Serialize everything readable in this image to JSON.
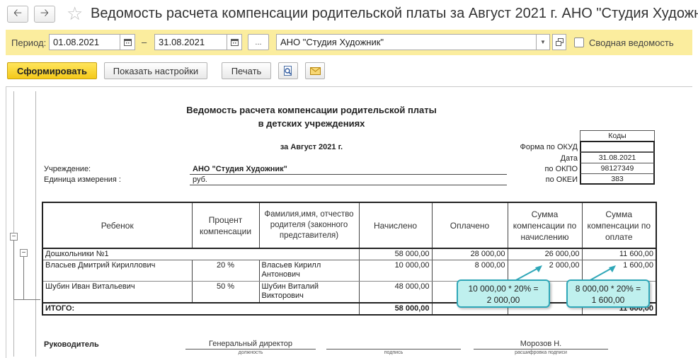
{
  "window": {
    "title": "Ведомость расчета компенсации родительской платы за Август 2021 г. АНО \"Студия Художник\""
  },
  "params": {
    "period_label": "Период:",
    "date_from": "01.08.2021",
    "dash": "–",
    "date_to": "31.08.2021",
    "ellipsis": "...",
    "org": "АНО \"Студия Художник\"",
    "summary_label": "Сводная ведомость"
  },
  "toolbar": {
    "generate": "Сформировать",
    "settings": "Показать настройки",
    "print": "Печать"
  },
  "report": {
    "title_line1": "Ведомость расчета компенсации родительской платы",
    "title_line2": "в детских учреждениях",
    "period": "за Август 2021 г.",
    "institution_label": "Учреждение:",
    "institution": "АНО \"Студия Художник\"",
    "unit_label": "Единица измерения :",
    "unit": "руб.",
    "codes": {
      "header": "Коды",
      "form_label": "Форма  по ОКУД",
      "form_value": "",
      "date_label": "Дата",
      "date_value": "31.08.2021",
      "okpo_label": "по ОКПО",
      "okpo_value": "98127349",
      "okei_label": "по ОКЕИ",
      "okei_value": "383"
    },
    "columns": {
      "child": "Ребенок",
      "percent": "Процент компенсации",
      "parent": "Фамилия,имя, отчество родителя (законного представителя)",
      "accrued": "Начислено",
      "paid": "Оплачено",
      "comp_accrued": "Сумма компенсации по начислению",
      "comp_paid": "Сумма компенсации по оплате"
    },
    "group": {
      "name": "Дошкольники №1",
      "accrued": "58 000,00",
      "paid": "28 000,00",
      "comp_accrued": "26 000,00",
      "comp_paid": "11 600,00"
    },
    "rows": [
      {
        "child": "Власьев Дмитрий Кириллович",
        "percent": "20 %",
        "parent_l1": "Власьев Кирилл",
        "parent_l2": "Антонович",
        "accrued": "10 000,00",
        "paid": "8 000,00",
        "comp_accrued": "2 000,00",
        "comp_paid": "1 600,00"
      },
      {
        "child": "Шубин Иван Витальевич",
        "percent": "50 %",
        "parent_l1": "Шубин Виталий",
        "parent_l2": "Викторович",
        "accrued": "48 000,00",
        "paid": "",
        "comp_accrued": "",
        "comp_paid": ""
      }
    ],
    "total": {
      "label": "ИТОГО:",
      "accrued": "58 000,00",
      "comp_paid_partial": "11 600,00"
    },
    "signature": {
      "label": "Руководитель",
      "position": "Генеральный директор",
      "position_caption": "должность",
      "sign_caption": "подпись",
      "name": "Морозов Н.",
      "name_caption": "расшифровка подписи"
    }
  },
  "callouts": {
    "c1_line1": "10 000,00 * 20% =",
    "c1_line2": "2 000,00",
    "c2_line1": "8 000,00 * 20% =",
    "c2_line2": "1 600,00"
  },
  "colors": {
    "panel": "#fbed9e",
    "primary": "#f4c919",
    "callout_bg": "#bff0ee",
    "callout_border": "#2fa7b8"
  }
}
